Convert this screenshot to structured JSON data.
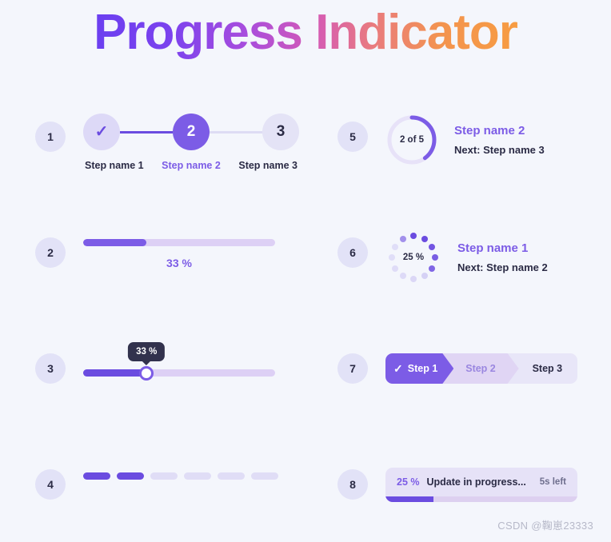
{
  "page": {
    "title": "Progress Indicator",
    "background_color": "#f4f6fc",
    "accent_color": "#7c5ce6",
    "accent_dark": "#6b4ce0",
    "gradient_start": "#6b3ff0",
    "gradient_end": "#f79c42",
    "watermark": "CSDN @鞠崽23333"
  },
  "items": [
    {
      "number": "1",
      "type": "stepper",
      "steps": [
        {
          "indicator": "check-icon",
          "label": "Step name 1",
          "state": "done"
        },
        {
          "indicator": "2",
          "label": "Step name 2",
          "state": "active"
        },
        {
          "indicator": "3",
          "label": "Step name 3",
          "state": "todo"
        }
      ]
    },
    {
      "number": "2",
      "type": "progress-bar",
      "percent": 33,
      "percent_label": "33 %"
    },
    {
      "number": "3",
      "type": "slider",
      "percent": 33,
      "tooltip_label": "33 %"
    },
    {
      "number": "4",
      "type": "segments",
      "total": 6,
      "filled": 2
    },
    {
      "number": "5",
      "type": "ring",
      "ring_label": "2 of 5",
      "percent": 40,
      "title": "Step name 2",
      "subtitle": "Next: Step name 3"
    },
    {
      "number": "6",
      "type": "dot-spinner",
      "center_label": "25 %",
      "percent": 25,
      "dot_count": 12,
      "title": "Step name 1",
      "subtitle": "Next: Step name 2"
    },
    {
      "number": "7",
      "type": "chevron-steps",
      "steps": [
        {
          "label": "Step 1",
          "state": "done",
          "indicator": "check-icon"
        },
        {
          "label": "Step 2",
          "state": "active"
        },
        {
          "label": "Step 3",
          "state": "todo"
        }
      ]
    },
    {
      "number": "8",
      "type": "update-card",
      "percent_label": "25 %",
      "percent": 25,
      "message": "Update in progress...",
      "time_left": "5s left"
    }
  ]
}
